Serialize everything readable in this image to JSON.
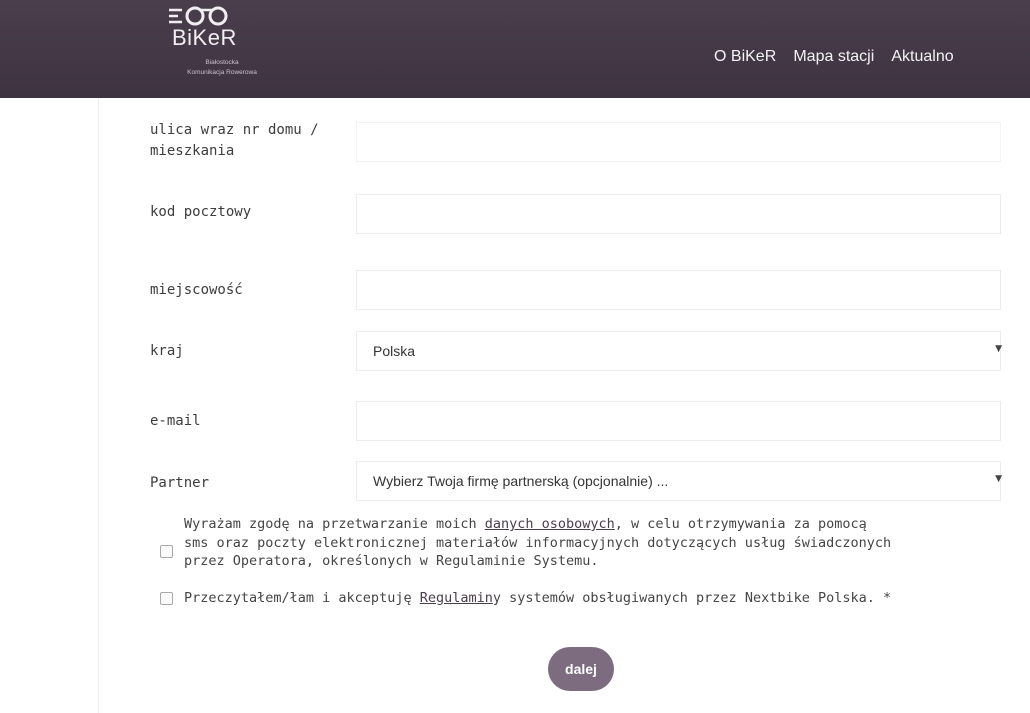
{
  "header": {
    "logo": {
      "brand": "BiKeR",
      "sub_line1": "Białostocka",
      "sub_line2": "Komunikacja Rowerowa"
    },
    "nav": [
      "O BiKeR",
      "Mapa stacji",
      "Aktualno"
    ]
  },
  "form": {
    "street_label_line1": "ulica wraz nr domu /",
    "street_label_line2": "mieszkania",
    "postal_label": "kod pocztowy",
    "city_label": "miejscowość",
    "country_label": "kraj",
    "country_value": "Polska",
    "email_label": "e-mail",
    "partner_label": "Partner",
    "partner_value": "Wybierz Twoja firmę partnerską (opcjonalnie) ..."
  },
  "consents": {
    "marketing_line1_a": "Wyrażam zgodę na przetwarzanie moich ",
    "marketing_link": "danych osobowych",
    "marketing_line1_b": ", w celu otrzymywania za pomocą",
    "marketing_line2": "sms oraz poczty elektronicznej materiałów informacyjnych dotyczących usług świadczonych",
    "marketing_line3": "przez Operatora, określonych w Regulaminie Systemu.",
    "terms_a": "Przeczytałem/łam i akceptuję ",
    "terms_link": "Regulamin",
    "terms_b": "y systemów obsługiwanych przez Nextbike Polska. *"
  },
  "submit_label": "dalej",
  "colors": {
    "header_bg": "#4a3e4c",
    "button_bg": "#7d6c80"
  }
}
